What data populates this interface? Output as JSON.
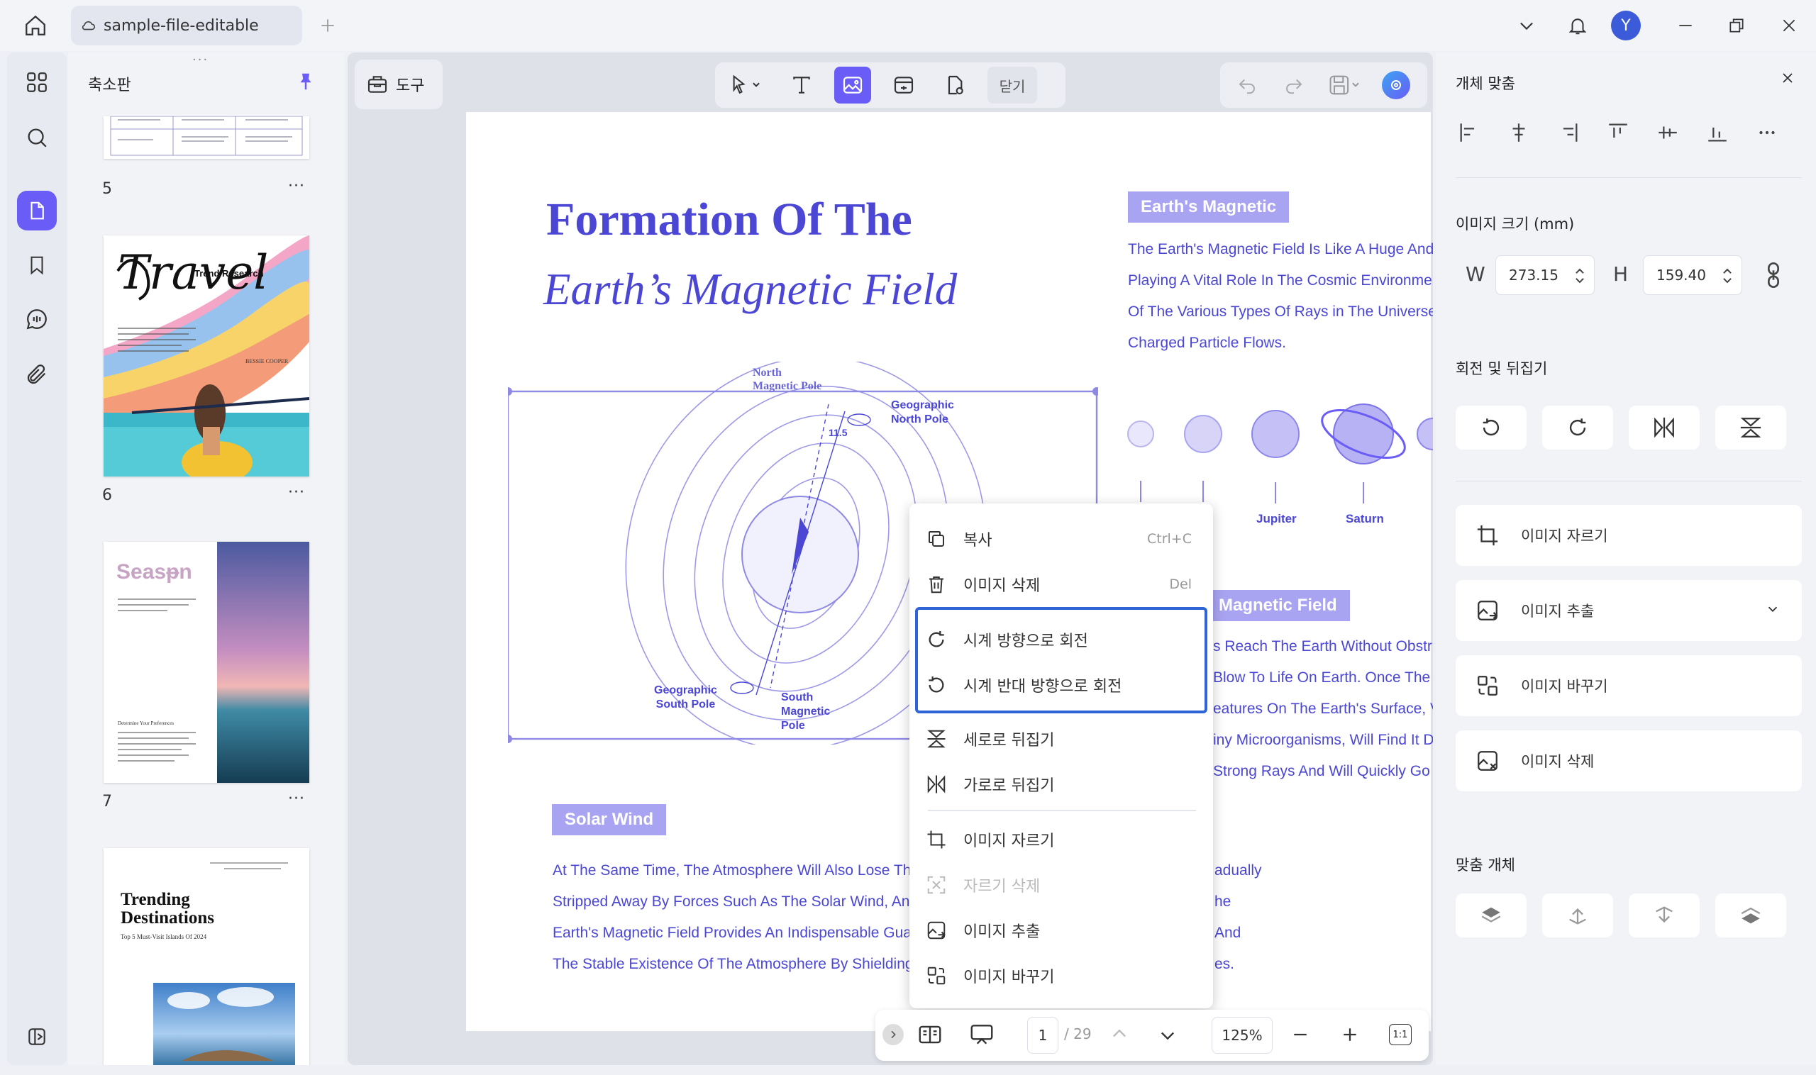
{
  "window": {
    "doc_tab": "sample-file-editable",
    "avatar_initial": "Y"
  },
  "thumbnails": {
    "title": "축소판",
    "pages": [
      {
        "num": "5",
        "more": "···"
      },
      {
        "num": "6",
        "more": "···"
      },
      {
        "num": "7",
        "more": "···"
      }
    ],
    "page6": {
      "title": "Travel",
      "subtitle": "Trend Research",
      "author": "BESSIE COOPER"
    },
    "page7": {
      "title": "Season",
      "heading": "Determine Your Preferences"
    },
    "page8": {
      "title": "Trending Destinations",
      "subtitle": "Top 5 Must-Visit Islands Of 2024"
    }
  },
  "toolbar": {
    "tools_label": "도구",
    "close_label": "닫기"
  },
  "document": {
    "title_line1": "Formation Of The",
    "title_line2": "Earth’s Magnetic Field",
    "badge1": "Earth's Magnetic",
    "para1": [
      "The Earth's Magnetic Field Is Like A Huge And",
      "Playing A Vital Role In The Cosmic Environmen",
      "Of The Various Types Of Rays in The Universe",
      "Charged Particle Flows."
    ],
    "planets": [
      "Jupiter",
      "Saturn"
    ],
    "badge2": "Magnetic Field",
    "para2": [
      "s Reach The Earth Without Obstru",
      "Blow To Life On Earth. Once The",
      "eatures On The Earth's Surface, V",
      "iny Microorganisms, Will Find It D",
      "Strong Rays And Will Quickly Go"
    ],
    "badge3": "Solar Wind",
    "para3": [
      "At The Same Time, The Atmosphere Will Also Lose Th",
      "Stripped Away By Forces Such As The Solar Wind, An",
      "Earth's Magnetic Field Provides An Indispensable Gua",
      "The Stable Existence Of The Atmosphere By Shielding"
    ],
    "para3_right": [
      "adually",
      "he",
      "And",
      "es."
    ],
    "diagram": {
      "north_magnetic": "North\nMagnetic Pole",
      "north_mag_1": "North",
      "north_mag_2": "Magnetic Pole",
      "geo_north_1": "Geographic",
      "geo_north_2": "North Pole",
      "angle": "11.5",
      "geo_south_1": "Geographic",
      "geo_south_2": "South Pole",
      "south_mag_1": "South",
      "south_mag_2": "Magnetic",
      "south_mag_3": "Pole"
    }
  },
  "context_menu": {
    "items": [
      {
        "label": "복사",
        "shortcut": "Ctrl+C"
      },
      {
        "label": "이미지 삭제",
        "shortcut": "Del"
      },
      {
        "label": "시계 방향으로 회전",
        "shortcut": ""
      },
      {
        "label": "시계 반대 방향으로 회전",
        "shortcut": ""
      },
      {
        "label": "세로로 뒤집기",
        "shortcut": ""
      },
      {
        "label": "가로로 뒤집기",
        "shortcut": ""
      },
      {
        "label": "이미지 자르기",
        "shortcut": ""
      },
      {
        "label": "자르기 삭제",
        "shortcut": ""
      },
      {
        "label": "이미지 추출",
        "shortcut": ""
      },
      {
        "label": "이미지 바꾸기",
        "shortcut": ""
      }
    ],
    "highlight_color": "#2f64d6"
  },
  "right_panel": {
    "align_title": "개체 맞춤",
    "size_title": "이미지 크기 (mm)",
    "w_label": "W",
    "w_value": "273.15",
    "h_label": "H",
    "h_value": "159.40",
    "rotate_title": "회전 및 뒤집기",
    "actions": [
      "이미지 자르기",
      "이미지 추출",
      "이미지 바꾸기",
      "이미지 삭제"
    ],
    "arrange_title": "맞춤 개체"
  },
  "bottom_bar": {
    "page_current": "1",
    "page_total": "/ 29",
    "zoom": "125%",
    "fit": "1:1"
  },
  "colors": {
    "accent": "#6a5cf6",
    "doc_text": "#4b47d4",
    "badge_bg": "#a9a4f2"
  }
}
